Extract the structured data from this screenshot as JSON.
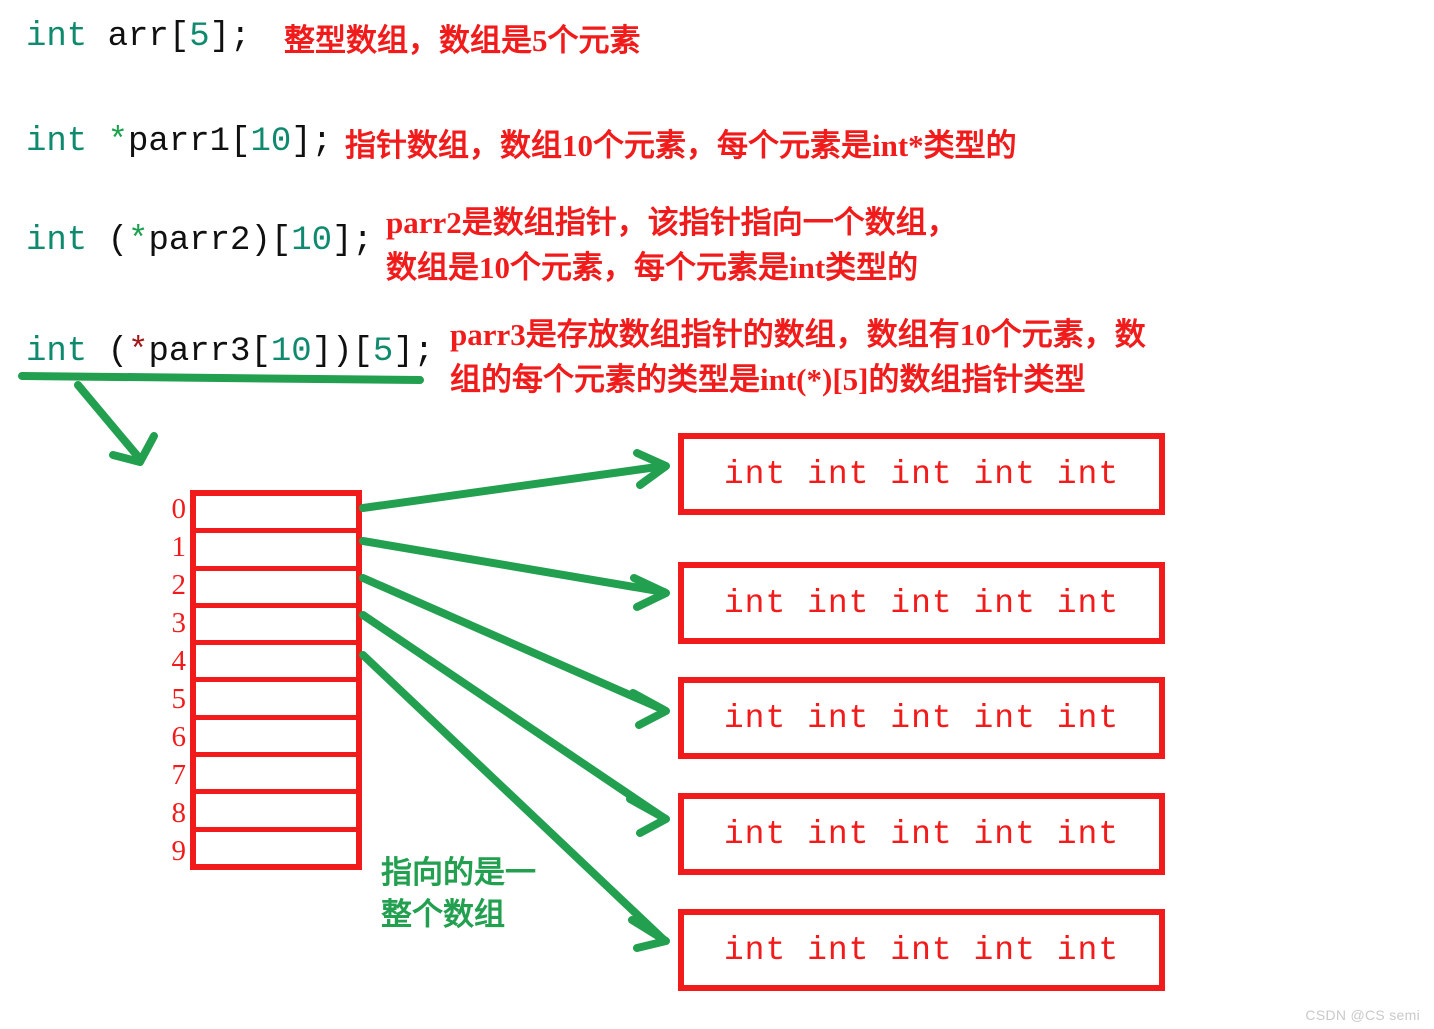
{
  "declarations": [
    {
      "id": "arr",
      "code_plain": "int arr[5];",
      "parts": {
        "kw": "int",
        "sp1": " ",
        "name": "arr",
        "lb": "[",
        "num": "5",
        "rb": "]",
        "semi": ";"
      },
      "note": "整型数组，数组是5个元素"
    },
    {
      "id": "parr1",
      "code_plain": "int *parr1[10];",
      "parts": {
        "kw": "int",
        "sp1": " ",
        "star": "*",
        "name": "parr1",
        "lb": "[",
        "num": "10",
        "rb": "]",
        "semi": ";"
      },
      "note": "指针数组，数组10个元素，每个元素是int*类型的"
    },
    {
      "id": "parr2",
      "code_plain": "int (*parr2)[10];",
      "parts": {
        "kw": "int",
        "sp1": " ",
        "lp": "(",
        "star": "*",
        "name": "parr2",
        "rp": ")",
        "lb": "[",
        "num": "10",
        "rb": "]",
        "semi": ";"
      },
      "note_line1": "parr2是数组指针，该指针指向一个数组，",
      "note_line2": "数组是10个元素，每个元素是int类型的"
    },
    {
      "id": "parr3",
      "code_plain": "int (*parr3[10])[5];",
      "parts": {
        "kw": "int",
        "sp1": " ",
        "lp": "(",
        "star": "*",
        "name": "parr3",
        "lb1": "[",
        "num1": "10",
        "rb1": "]",
        "rp": ")",
        "lb2": "[",
        "num2": "5",
        "rb2": "]",
        "semi": ";"
      },
      "note_line1": "parr3是存放数组指针的数组，数组有10个元素，数",
      "note_line2": "组的每个元素的类型是int(*)[5]的数组指针类型"
    }
  ],
  "diagram": {
    "pointer_array": {
      "label": "parr3",
      "element_count": 10,
      "indices": [
        "0",
        "1",
        "2",
        "3",
        "4",
        "5",
        "6",
        "7",
        "8",
        "9"
      ]
    },
    "target_arrays": [
      {
        "cells": "int int int int int",
        "from_index": "0"
      },
      {
        "cells": "int int int int int",
        "from_index": "1"
      },
      {
        "cells": "int int int int int",
        "from_index": "2"
      },
      {
        "cells": "int int int int int",
        "from_index": "3"
      },
      {
        "cells": "int int int int int",
        "from_index": "4"
      }
    ],
    "annotation_line1": "指向的是一",
    "annotation_line2": "整个数组"
  },
  "watermark": "CSDN @CS semi",
  "colors": {
    "red": "#f21b1b",
    "green": "#22a050",
    "keyword_teal": "#0f8a6e",
    "star_green": "#1aa14e",
    "star_red": "#a11717",
    "ink": "#101010",
    "watermark_gray": "#c9c9c9"
  }
}
